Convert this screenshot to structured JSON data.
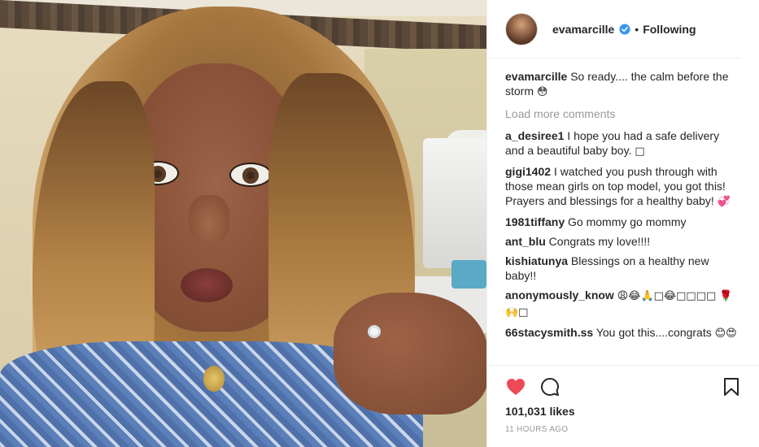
{
  "post": {
    "image_alt": "Selfie photo",
    "header": {
      "username": "evamarcille",
      "separator": "•",
      "follow_status": "Following"
    },
    "caption": {
      "username": "evamarcille",
      "text": "So ready.... the calm before the storm",
      "emoji": "😳"
    },
    "load_more": "Load more comments",
    "comments": [
      {
        "username": "a_desiree1",
        "text": "I hope you had a safe delivery and a beautiful baby boy. ",
        "emoji": "□"
      },
      {
        "username": "gigi1402",
        "text": "I watched you push through with those mean girls on top model, you got this! Prayers and blessings for a healthy baby! ",
        "emoji": "💞"
      },
      {
        "username": "1981tiffany",
        "text": "Go mommy go mommy",
        "emoji": ""
      },
      {
        "username": "ant_blu",
        "text": "Congrats my love!!!!",
        "emoji": ""
      },
      {
        "username": "kishiatunya",
        "text": "Blessings on a healthy new baby!!",
        "emoji": ""
      },
      {
        "username": "anonymously_know",
        "text": "",
        "emoji": "😩😂🙏□😂□□□□ 🌹🙌□"
      },
      {
        "username": "66stacysmith.ss",
        "text": "You got this....congrats ",
        "emoji": "😊😍"
      }
    ],
    "likes": "101,031 likes",
    "timestamp": "11 HOURS AGO",
    "icons": {
      "like": "heart-icon",
      "comment": "comment-icon",
      "save": "bookmark-icon",
      "verified": "verified-badge-icon"
    },
    "colors": {
      "like_red": "#ed4956",
      "verified_blue": "#3897f0",
      "muted": "#999999"
    }
  }
}
